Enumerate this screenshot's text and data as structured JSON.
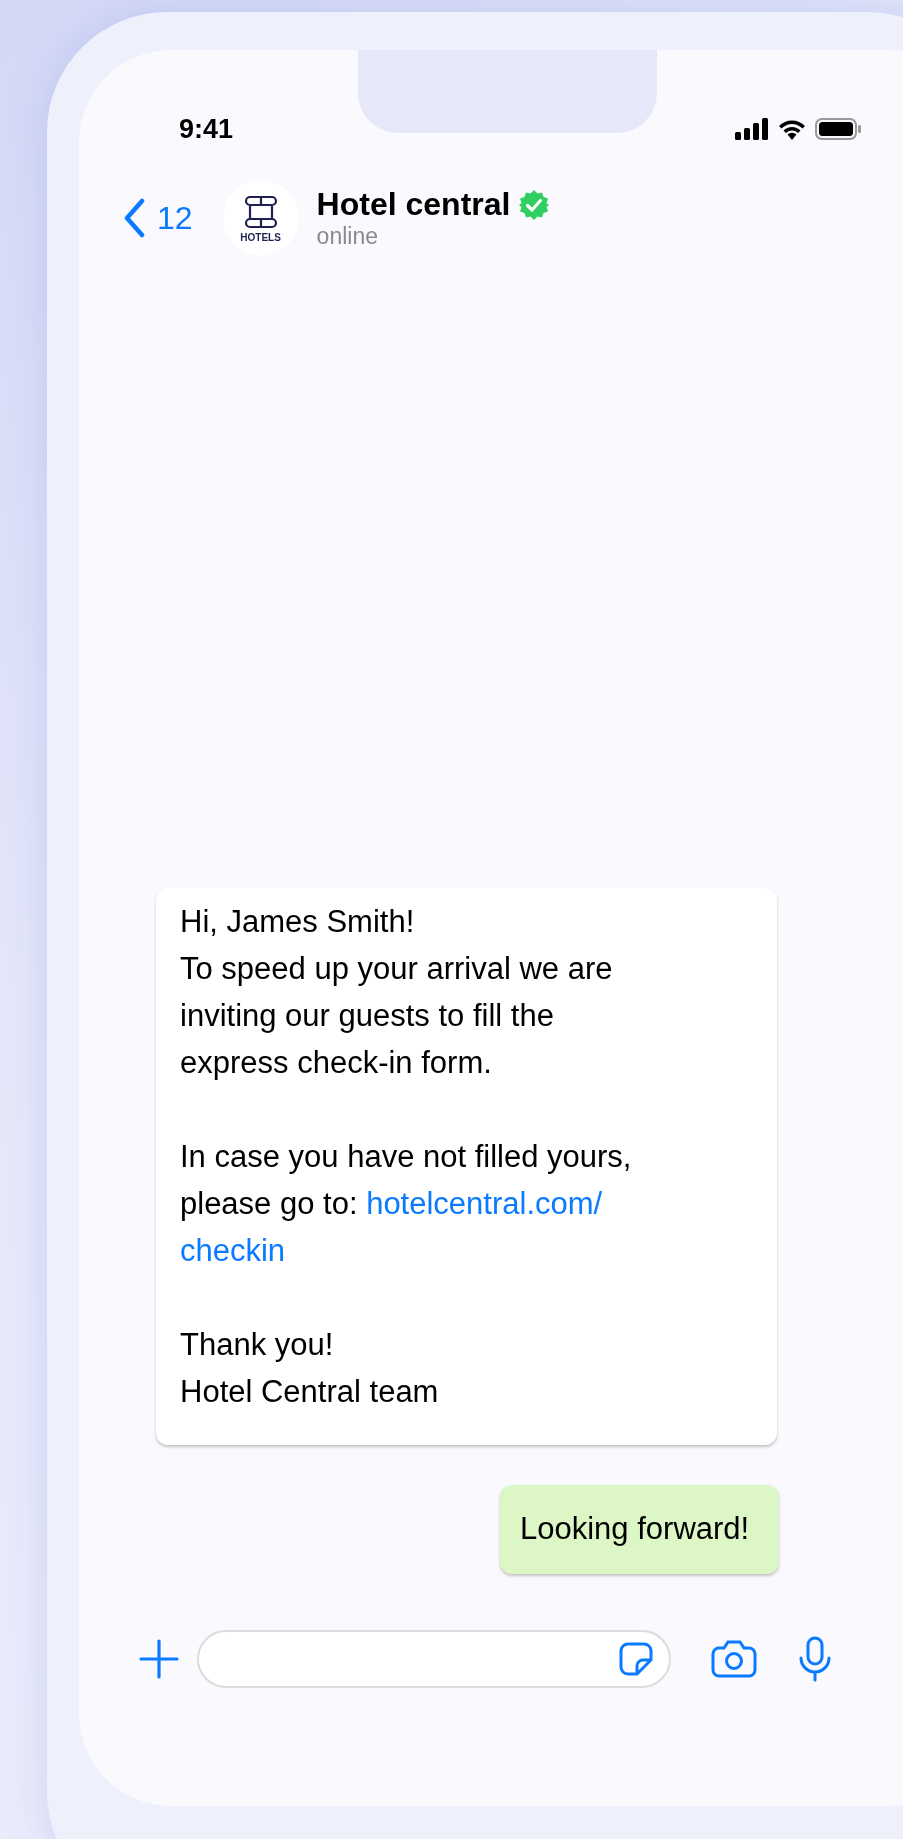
{
  "status_bar": {
    "time": "9:41"
  },
  "header": {
    "back_count": "12",
    "avatar_caption": "HOTELS",
    "title": "Hotel central",
    "verified": true,
    "presence": "online"
  },
  "messages": [
    {
      "kind": "incoming",
      "paragraphs": [
        {
          "lines": [
            "Hi, James Smith!",
            "To speed up your arrival we are inviting our guests to fill the express check-in form."
          ]
        },
        {
          "lines": [
            "In case you have not filled yours, please go to: "
          ],
          "link_lines": [
            "hotelcentral.com/",
            "checkin"
          ]
        },
        {
          "lines": [
            "Thank you!",
            "Hotel Central team"
          ]
        }
      ]
    },
    {
      "kind": "outgoing",
      "paragraphs": [
        {
          "lines": [
            "Looking forward!"
          ]
        }
      ]
    }
  ]
}
